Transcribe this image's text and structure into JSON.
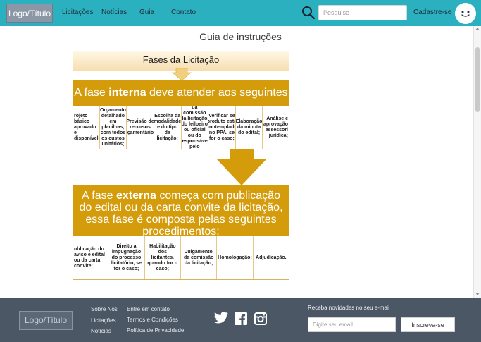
{
  "header": {
    "logo": "Logo/Título",
    "nav": [
      {
        "label": "Licitações"
      },
      {
        "label": "Notícias"
      },
      {
        "label": "Guia"
      },
      {
        "label": "Contato"
      }
    ],
    "search_placeholder": "Pesquise",
    "signup": "Cadastre-se",
    "brand_color": "#2bb0c0",
    "search_icon": "search-icon",
    "avatar_icon": "smiley-face-icon"
  },
  "main": {
    "title": "Guia de instruções",
    "phases_title": "Fases da Licitação",
    "internal": {
      "prefix": "A fase ",
      "highlight": "interna",
      "suffix": " deve atender aos seguintes requisitos:",
      "items": [
        "rojeto básico aprovado e disponível;",
        "Orçamento detalhado em planilhas, com todos os custos unitários;",
        "Previsão de recursos orçamentários;",
        "Escolha da modalidade e do tipo da licitação;",
        "Designação da comissão da licitação, do leiloeiro ou oficial ou do responsável pelo convite;",
        "Verificar se produto está contemplado no PPA, se for o caso;",
        "Elaboração da minuta do edital;",
        "Análise e aprovação assessori jurídica;"
      ]
    },
    "external": {
      "prefix": "A fase ",
      "highlight": "externa",
      "suffix": " começa com  publicação do edital ou da carta convite da licitação, essa fase é composta pelas seguintes procedimentos:",
      "items": [
        "ublicação do aviso e edital ou da carta convite;",
        "Direito a impugnação do processo licitatório, se for o caso;",
        "Habilitação dos licitantes, quando for o caso;",
        "Julgamento da comissão da licitação;",
        "Homologação;",
        "Adjudicação."
      ]
    },
    "accent_color": "#d49b0b"
  },
  "footer": {
    "logo": "Logo/Título",
    "links_col1": [
      "Sobre Nós",
      "Licitações",
      "Notícias"
    ],
    "links_col2": [
      "Entre em contato",
      "Termos e Condições",
      "Política de Privacidade"
    ],
    "social_icons": [
      "twitter-icon",
      "facebook-icon",
      "instagram-icon"
    ],
    "newsletter_label": "Receba novidades no seu e-mail",
    "email_placeholder": "Digite seu email",
    "subscribe": "Inscreva-se",
    "background_color": "#4c5766"
  }
}
